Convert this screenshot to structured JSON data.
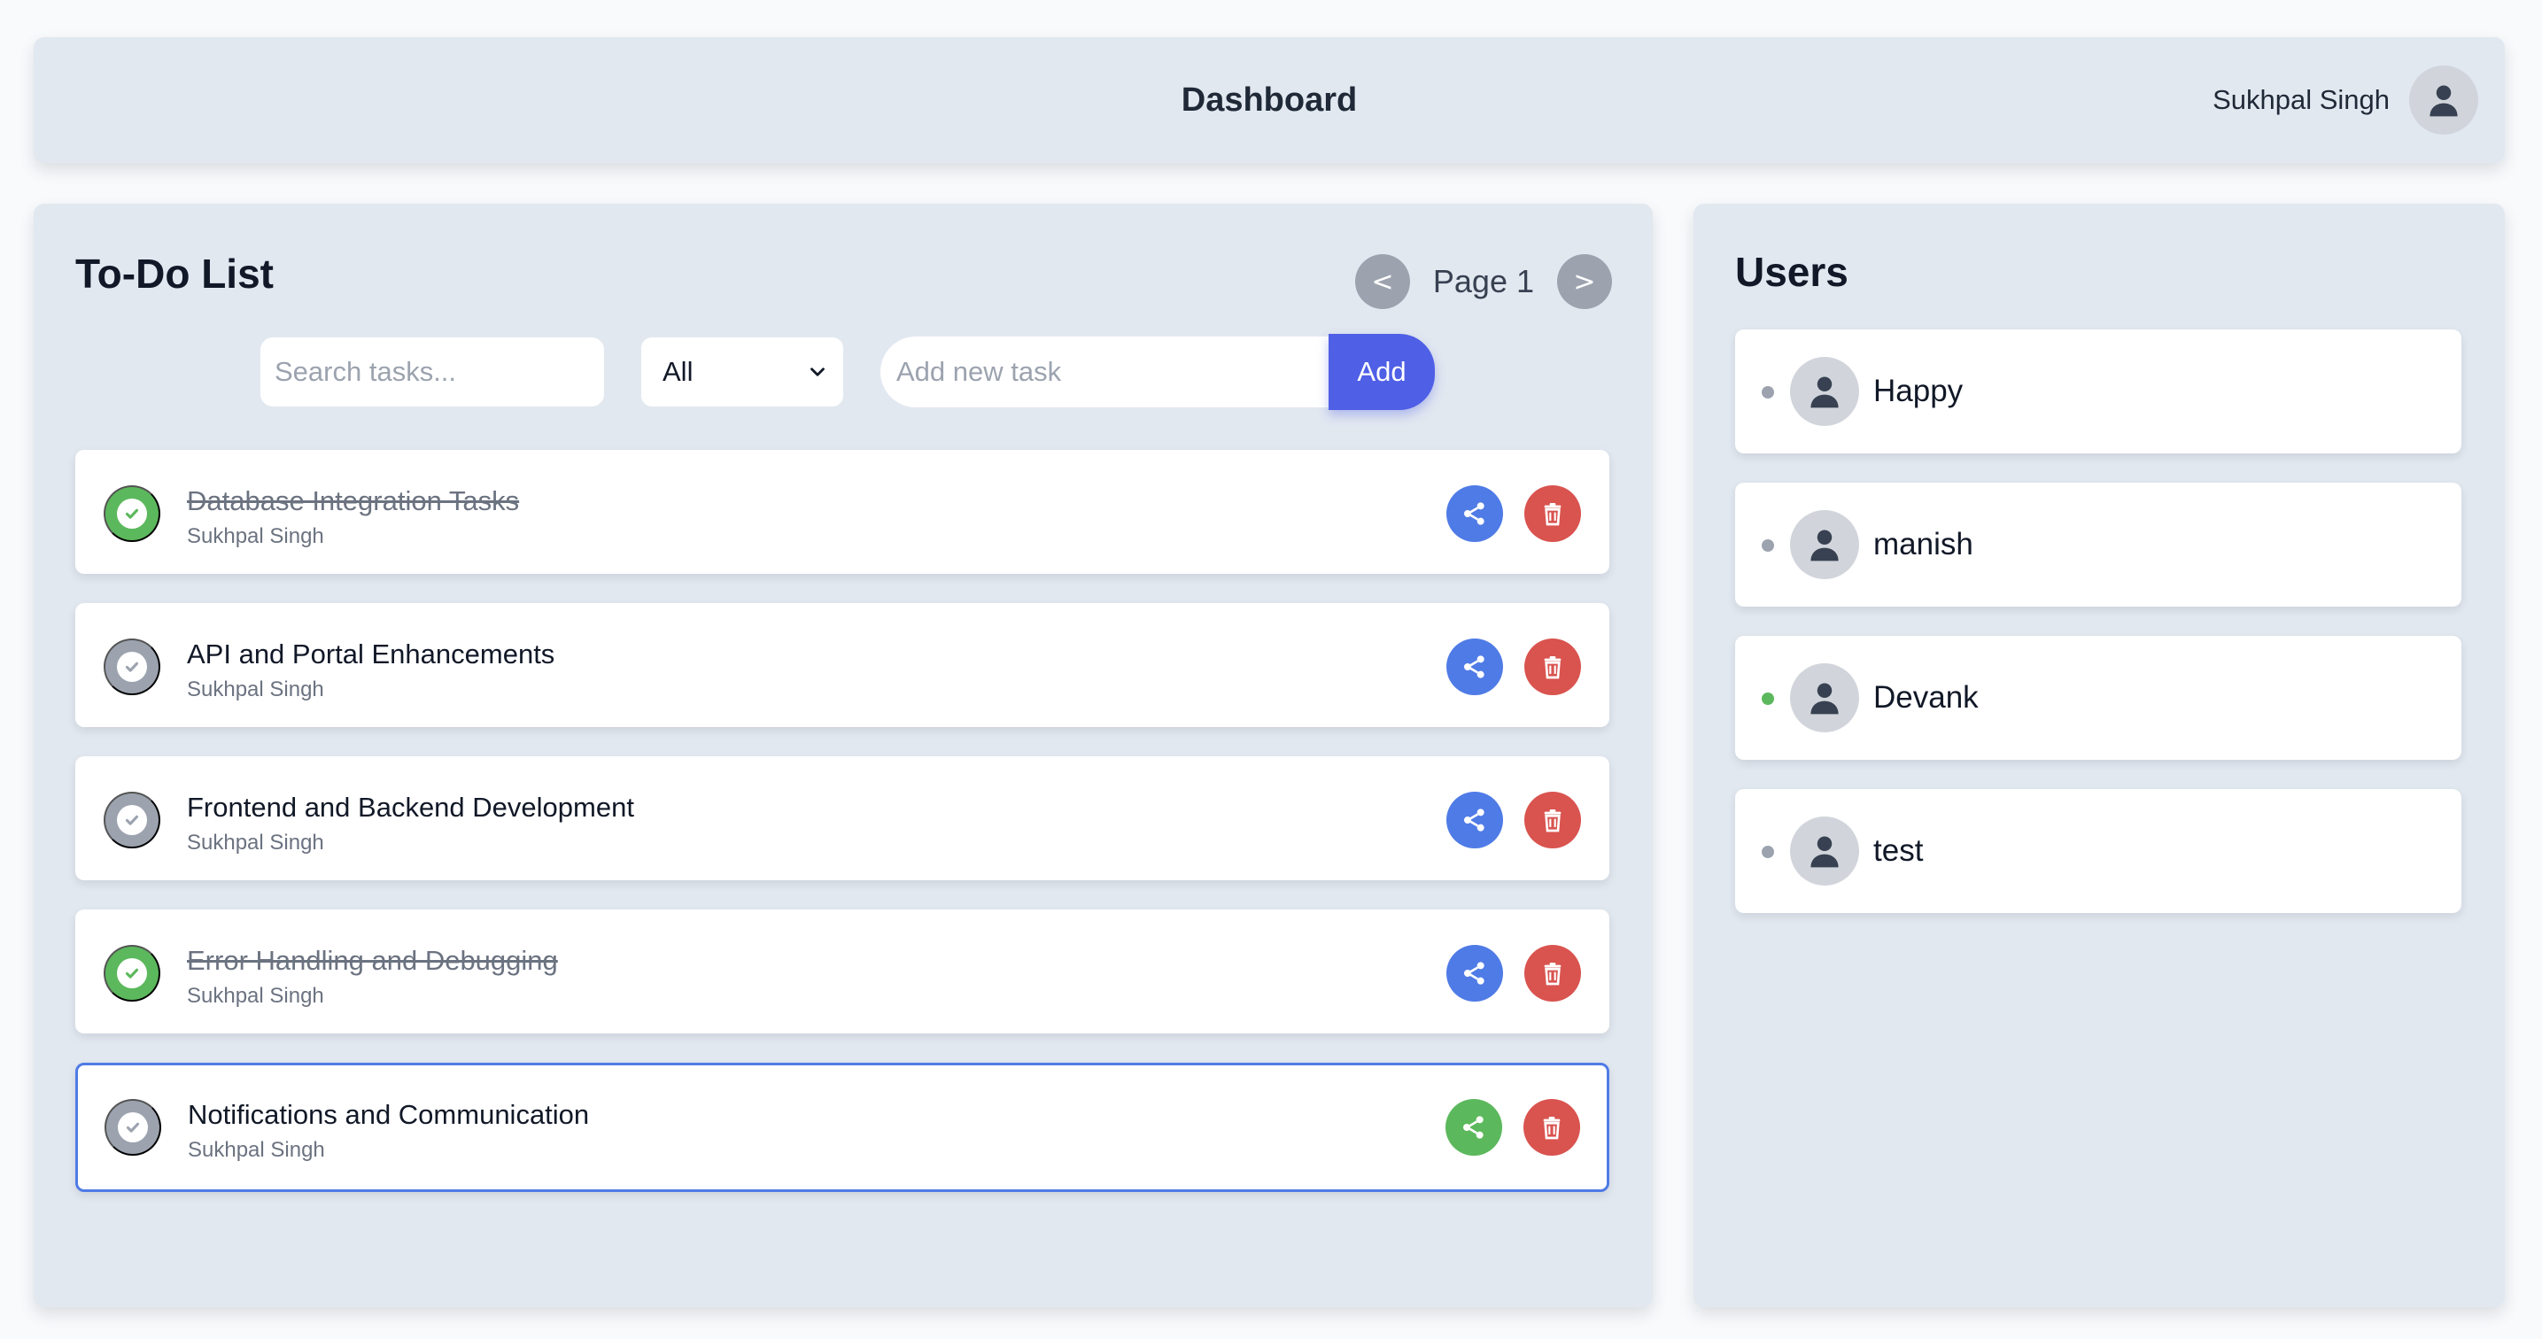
{
  "header": {
    "title": "Dashboard",
    "user_name": "Sukhpal Singh"
  },
  "todo": {
    "title": "To-Do List",
    "pager": {
      "prev_label": "<",
      "next_label": ">",
      "page_label": "Page 1"
    },
    "search": {
      "placeholder": "Search tasks..."
    },
    "filter": {
      "selected": "All"
    },
    "add": {
      "placeholder": "Add new task",
      "button_label": "Add"
    },
    "tasks": [
      {
        "name": "Database Integration Tasks",
        "owner": "Sukhpal Singh",
        "completed": true
      },
      {
        "name": "API and Portal Enhancements",
        "owner": "Sukhpal Singh",
        "completed": false
      },
      {
        "name": "Frontend and Backend Development",
        "owner": "Sukhpal Singh",
        "completed": false
      },
      {
        "name": "Error Handling and Debugging",
        "owner": "Sukhpal Singh",
        "completed": true
      },
      {
        "name": "Notifications and Communication",
        "owner": "Sukhpal Singh",
        "completed": false,
        "selected": true
      }
    ]
  },
  "users": {
    "title": "Users",
    "list": [
      {
        "name": "Happy",
        "status": "offline"
      },
      {
        "name": "manish",
        "status": "offline"
      },
      {
        "name": "Devank",
        "status": "online"
      },
      {
        "name": "test",
        "status": "offline"
      }
    ]
  },
  "colors": {
    "online": "#5cb85c",
    "offline": "#9ca3af",
    "accent": "#4f5fe6",
    "share": "#4f7be6",
    "danger": "#d9534f",
    "success": "#5cb85c"
  },
  "icons": {
    "avatar": "user-icon",
    "share": "share-icon",
    "delete": "trash-icon",
    "check": "check-icon",
    "dropdown": "chevron-down-icon"
  }
}
